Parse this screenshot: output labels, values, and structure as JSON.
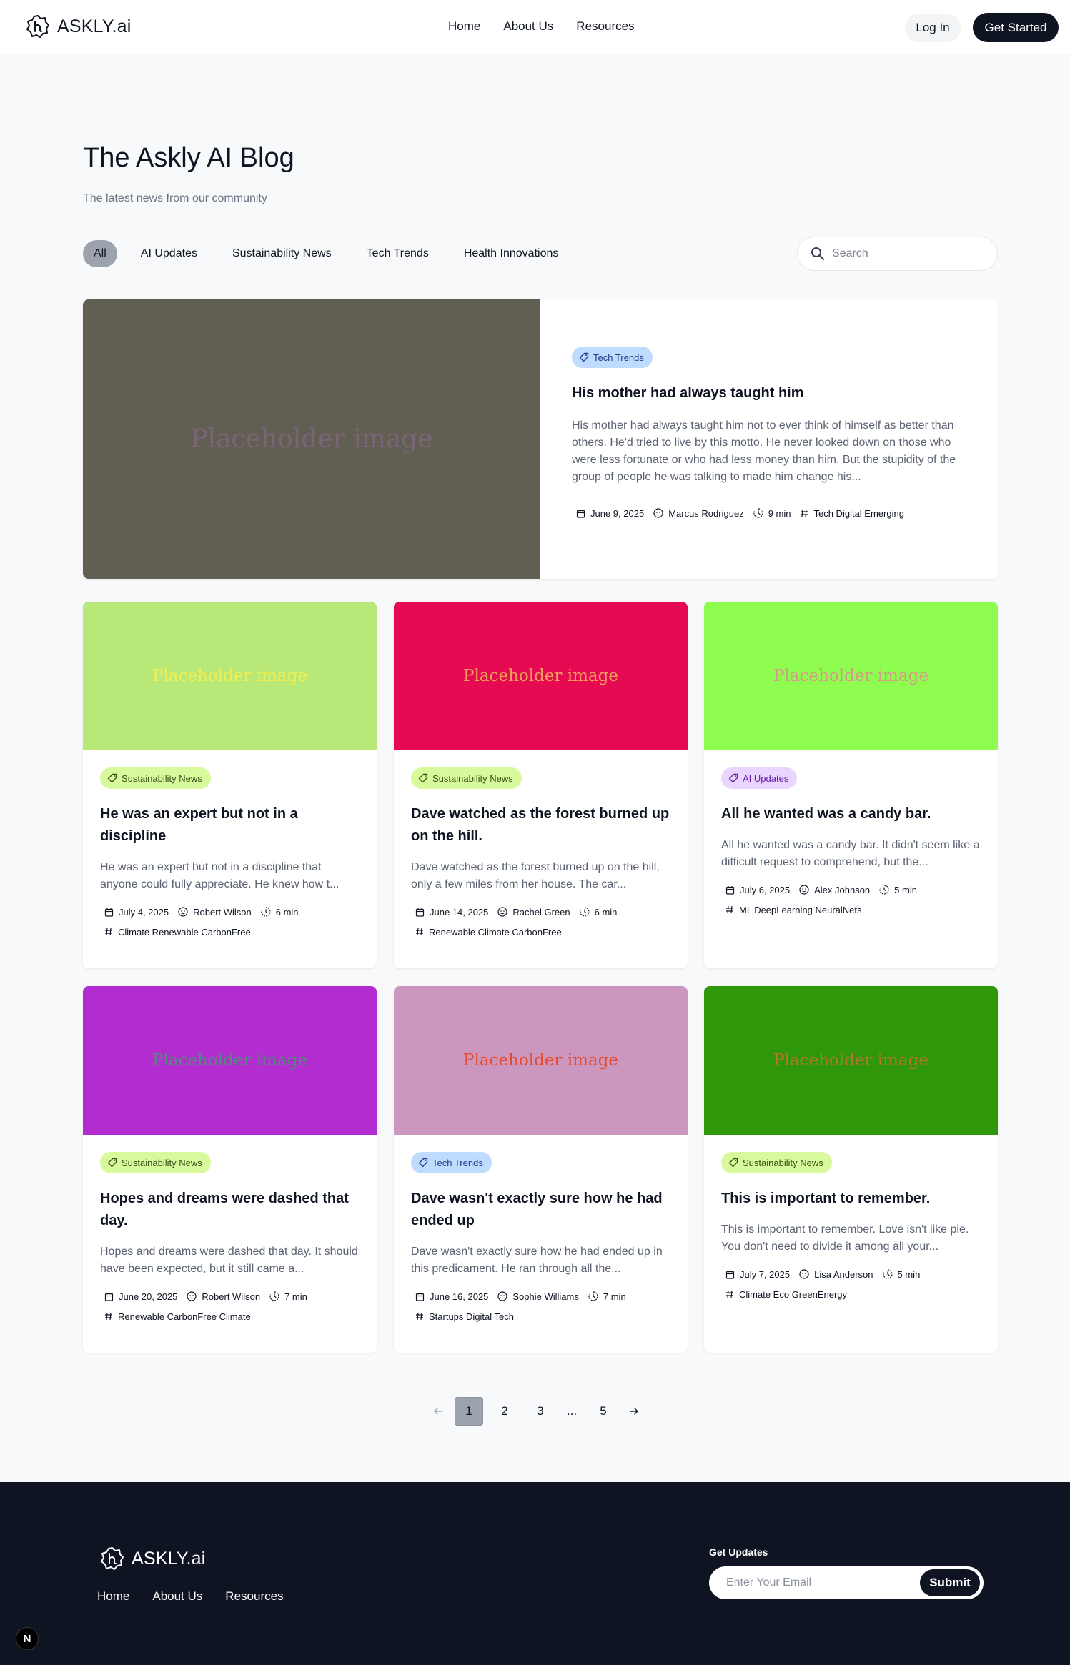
{
  "header": {
    "brand": "ASKLY.ai",
    "nav": [
      "Home",
      "About Us",
      "Resources"
    ],
    "login": "Log In",
    "cta": "Get Started"
  },
  "hero": {
    "title": "The Askly AI Blog",
    "subtitle": "The latest news from our community"
  },
  "filters": {
    "categories": [
      "All",
      "AI Updates",
      "Sustainability News",
      "Tech Trends",
      "Health Innovations"
    ],
    "active": "All",
    "search_placeholder": "Search"
  },
  "featured": {
    "image_text": "Placeholder image",
    "image_bg": "#615f52",
    "image_fg": "#7a6477",
    "tag": "Tech Trends",
    "title": "His mother had always taught him",
    "excerpt": "His mother had always taught him not to ever think of himself as better than others. He'd tried to live by this motto. He never looked down on those who were less fortunate or who had less money than him. But the stupidity of the group of people he was talking to made him change his...",
    "date": "June 9, 2025",
    "author": "Marcus Rodriguez",
    "read_time": "9 min",
    "keywords": "Tech Digital Emerging"
  },
  "posts": [
    {
      "image_text": "Placeholder image",
      "image_bg": "#b8e878",
      "image_fg": "#f0ee50",
      "tag": "Sustainability News",
      "tag_color": "green",
      "title": "He was an expert but not in a discipline",
      "excerpt": "He was an expert but not in a discipline that anyone could fully appreciate. He knew how t...",
      "date": "July 4, 2025",
      "author": "Robert Wilson",
      "read_time": "6 min",
      "keywords": "Climate Renewable CarbonFree"
    },
    {
      "image_text": "Placeholder image",
      "image_bg": "#e50a52",
      "image_fg": "#f0a05a",
      "tag": "Sustainability News",
      "tag_color": "green",
      "title": "Dave watched as the forest burned up on the hill.",
      "excerpt": "Dave watched as the forest burned up on the hill, only a few miles from her house. The car...",
      "date": "June 14, 2025",
      "author": "Rachel Green",
      "read_time": "6 min",
      "keywords": "Renewable Climate CarbonFree"
    },
    {
      "image_text": "Placeholder image",
      "image_bg": "#8ffd50",
      "image_fg": "#d79a8a",
      "tag": "AI Updates",
      "tag_color": "purple",
      "title": "All he wanted was a candy bar.",
      "excerpt": "All he wanted was a candy bar. It didn't seem like a difficult request to comprehend, but the...",
      "date": "July 6, 2025",
      "author": "Alex Johnson",
      "read_time": "5 min",
      "keywords": "ML DeepLearning NeuralNets"
    },
    {
      "image_text": "Placeholder image",
      "image_bg": "#b22ccf",
      "image_fg": "#4f8a7a",
      "tag": "Sustainability News",
      "tag_color": "green",
      "title": "Hopes and dreams were dashed that day.",
      "excerpt": "Hopes and dreams were dashed that day. It should have been expected, but it still came a...",
      "date": "June 20, 2025",
      "author": "Robert Wilson",
      "read_time": "7 min",
      "keywords": "Renewable CarbonFree Climate"
    },
    {
      "image_text": "Placeholder image",
      "image_bg": "#cc97be",
      "image_fg": "#e64a2a",
      "tag": "Tech Trends",
      "tag_color": "blue",
      "title": "Dave wasn't exactly sure how he had ended up",
      "excerpt": "Dave wasn't exactly sure how he had ended up in this predicament. He ran through all the...",
      "date": "June 16, 2025",
      "author": "Sophie Williams",
      "read_time": "7 min",
      "keywords": "Startups Digital Tech"
    },
    {
      "image_text": "Placeholder image",
      "image_bg": "#2f970a",
      "image_fg": "#b6752e",
      "tag": "Sustainability News",
      "tag_color": "green",
      "title": "This is important to remember.",
      "excerpt": "This is important to remember. Love isn't like pie. You don't need to divide it among all your...",
      "date": "July 7, 2025",
      "author": "Lisa Anderson",
      "read_time": "5 min",
      "keywords": "Climate Eco GreenEnergy"
    }
  ],
  "pagination": {
    "pages": [
      "1",
      "2",
      "3",
      "...",
      "5"
    ],
    "current": "1",
    "prev": "←",
    "next": "→"
  },
  "footer": {
    "brand": "ASKLY.ai",
    "nav": [
      "Home",
      "About Us",
      "Resources"
    ],
    "updates_label": "Get Updates",
    "email_placeholder": "Enter Your Email",
    "submit": "Submit"
  },
  "dev_badge": "N"
}
